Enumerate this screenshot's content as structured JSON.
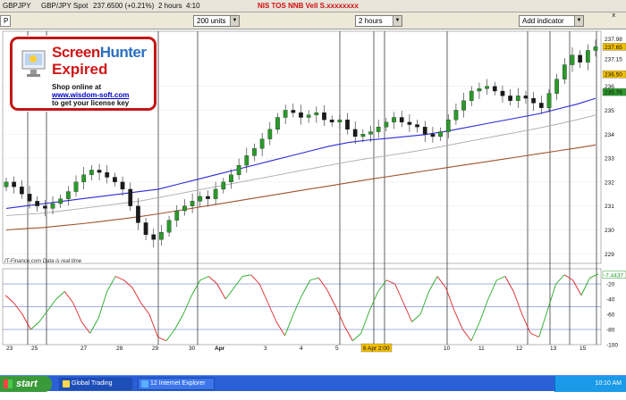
{
  "titlebar": {
    "symbol": "GBPJPY",
    "instrument": "GBP/JPY Spot",
    "price": "237.6500 (+0.21%)",
    "period": "2 hours",
    "time": "4:10",
    "warning": "NIS TOS NNB Vell S.xxxxxxxx"
  },
  "toolbar": {
    "units": "200 units",
    "interval": "2 hours",
    "add_indicator": "Add indicator",
    "close_btn": "x",
    "left_label": "P"
  },
  "chart_data": {
    "type": "candlestick",
    "title": "",
    "price_axis": [
      "237.98",
      "237.65",
      "237.15",
      "236.50",
      "236",
      "235.76",
      "235",
      "234",
      "233",
      "232",
      "231",
      "230",
      "229"
    ],
    "price_axis_numeric": [
      236,
      235,
      234,
      233,
      232,
      231,
      230,
      229
    ],
    "price_ylim": [
      228.6,
      238.3
    ],
    "price_labels_marked": [
      {
        "text": "237.65",
        "color": "#f2c000"
      },
      {
        "text": "236.50",
        "color": "#f2c000"
      },
      {
        "text": "235.76",
        "color": "#2a9a2a"
      }
    ],
    "x_labels": [
      "23",
      "25",
      "27",
      "28",
      "29",
      "30",
      "Apr",
      "3",
      "4",
      "5",
      "6 Apr 2:00",
      "10",
      "11",
      "12",
      "13",
      "15"
    ],
    "highlight_label": "6 Apr 2:00",
    "oscillator_axis": [
      "-20",
      "-40",
      "-60",
      "-80",
      "-100"
    ],
    "oscillator_value": "-7.4437",
    "oscillator_ylim": [
      -100,
      0
    ],
    "oscillator_levels": [
      -20,
      -50,
      -80
    ],
    "source_note": "IT-Finance.com  Data is real time",
    "closes": [
      232.0,
      231.8,
      231.5,
      231.2,
      231.0,
      230.9,
      231.1,
      231.3,
      231.6,
      232.0,
      232.3,
      232.5,
      232.4,
      232.2,
      232.0,
      231.7,
      231.0,
      230.3,
      229.8,
      229.6,
      229.9,
      230.4,
      230.8,
      231.0,
      231.2,
      231.4,
      231.3,
      231.7,
      232.0,
      232.3,
      232.7,
      233.1,
      233.4,
      233.8,
      234.2,
      234.7,
      235.0,
      234.9,
      234.7,
      234.8,
      234.9,
      234.6,
      234.5,
      234.6,
      234.2,
      233.9,
      234.0,
      234.1,
      234.3,
      234.5,
      234.7,
      234.5,
      234.4,
      234.3,
      234.0,
      233.9,
      234.1,
      234.6,
      235.0,
      235.4,
      235.8,
      235.9,
      236.0,
      235.8,
      235.6,
      235.4,
      235.6,
      235.5,
      235.3,
      235.1,
      235.7,
      236.3,
      236.9,
      237.3,
      237.0,
      237.5,
      237.65
    ],
    "ma_fast": [
      230.9,
      231.0,
      231.1,
      231.2,
      231.3,
      231.4,
      231.5,
      231.6,
      231.7,
      231.9,
      232.1,
      232.3,
      232.5,
      232.7,
      232.9,
      233.1,
      233.3,
      233.5,
      233.65,
      233.75,
      233.82,
      233.9,
      233.98,
      234.1,
      234.25,
      234.4,
      234.55,
      234.7,
      234.85,
      235.05,
      235.25,
      235.5
    ],
    "ma_mid": [
      230.6,
      230.65,
      230.7,
      230.8,
      230.9,
      231.0,
      231.1,
      231.2,
      231.35,
      231.5,
      231.65,
      231.8,
      231.95,
      232.1,
      232.25,
      232.4,
      232.55,
      232.7,
      232.85,
      232.98,
      233.1,
      233.22,
      233.35,
      233.5,
      233.65,
      233.8,
      233.95,
      234.1,
      234.25,
      234.42,
      234.6,
      234.8
    ],
    "ma_slow": [
      230.0,
      230.05,
      230.1,
      230.18,
      230.26,
      230.35,
      230.45,
      230.55,
      230.67,
      230.8,
      230.93,
      231.06,
      231.19,
      231.32,
      231.45,
      231.58,
      231.71,
      231.84,
      231.97,
      232.1,
      232.22,
      232.34,
      232.46,
      232.58,
      232.7,
      232.82,
      232.94,
      233.06,
      233.18,
      233.3,
      233.42,
      233.55
    ],
    "osc_k": [
      -35,
      -45,
      -60,
      -80,
      -70,
      -55,
      -40,
      -30,
      -45,
      -70,
      -85,
      -65,
      -30,
      -10,
      -15,
      -25,
      -45,
      -60,
      -90,
      -95,
      -80,
      -60,
      -35,
      -15,
      -10,
      -20,
      -40,
      -25,
      -10,
      -8,
      -20,
      -45,
      -70,
      -88,
      -60,
      -35,
      -15,
      -12,
      -28,
      -50,
      -75,
      -95,
      -85,
      -55,
      -30,
      -15,
      -20,
      -45,
      -70,
      -60,
      -30,
      -10,
      -25,
      -55,
      -80,
      -95,
      -70,
      -40,
      -15,
      -10,
      -30,
      -60,
      -85,
      -90,
      -55,
      -20,
      -8,
      -15,
      -35,
      -12,
      -7
    ],
    "verticals": [
      31,
      52,
      177,
      221,
      380,
      418,
      430,
      500,
      590,
      615,
      637,
      667
    ]
  },
  "watermark": {
    "brand_a": "Screen",
    "brand_b": "Hunter",
    "expired": "Expired",
    "line1": "Shop online at",
    "line2": "www.wisdom-soft.com",
    "line3": "to get your license key"
  },
  "taskbar": {
    "start": "start",
    "task1": "Global Trading Syste...",
    "task2": "12 Internet Explorer",
    "clock": "10:10 AM"
  },
  "colors": {
    "ma_fast": "#2a2ad8",
    "ma_mid": "#aaaaaa",
    "ma_slow": "#a0522d",
    "candle_up": "#2a9a2a",
    "candle_down": "#1a1a1a",
    "osc_up": "#22aa22",
    "osc_down": "#dd2222",
    "grid": "#b0b0b0",
    "vertical": "#222222",
    "marker": "#f2c000"
  }
}
